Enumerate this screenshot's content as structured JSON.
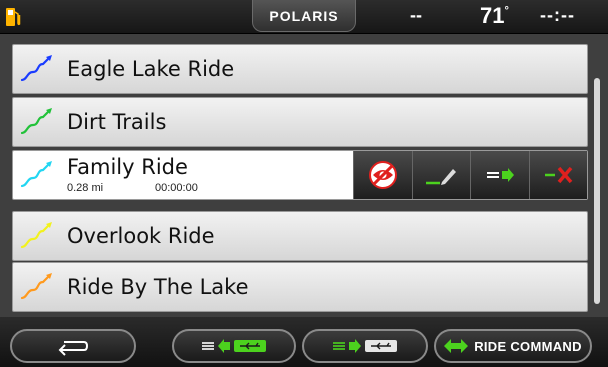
{
  "status_bar": {
    "brand": "POLARIS",
    "speed": "--",
    "temperature": "71",
    "temperature_unit": "°",
    "clock": "--:--",
    "fuel_icon": "fuel-pump-icon"
  },
  "rides": [
    {
      "name": "Eagle Lake Ride",
      "color": "#1a3cff"
    },
    {
      "name": "Dirt Trails",
      "color": "#22c23a"
    },
    {
      "name": "Family Ride",
      "color": "#22d6f2",
      "distance": "0.28 mi",
      "duration": "00:00:00"
    },
    {
      "name": "Overlook Ride",
      "color": "#f2f21e"
    },
    {
      "name": "Ride By The Lake",
      "color": "#ff9a1e"
    }
  ],
  "selected_actions": {
    "icons": [
      "hide-visibility-icon",
      "rename-icon",
      "send-icon",
      "delete-icon"
    ]
  },
  "bottom_bar": {
    "ride_command_label": "RIDE COMMAND",
    "back_icon": "back-arrow-icon",
    "import_icon": "import-from-usb-icon",
    "export_icon": "export-to-usb-icon"
  },
  "colors": {
    "accent_green": "#4cd21e",
    "delete_red": "#e0201e",
    "fuel_orange": "#ffb400"
  }
}
